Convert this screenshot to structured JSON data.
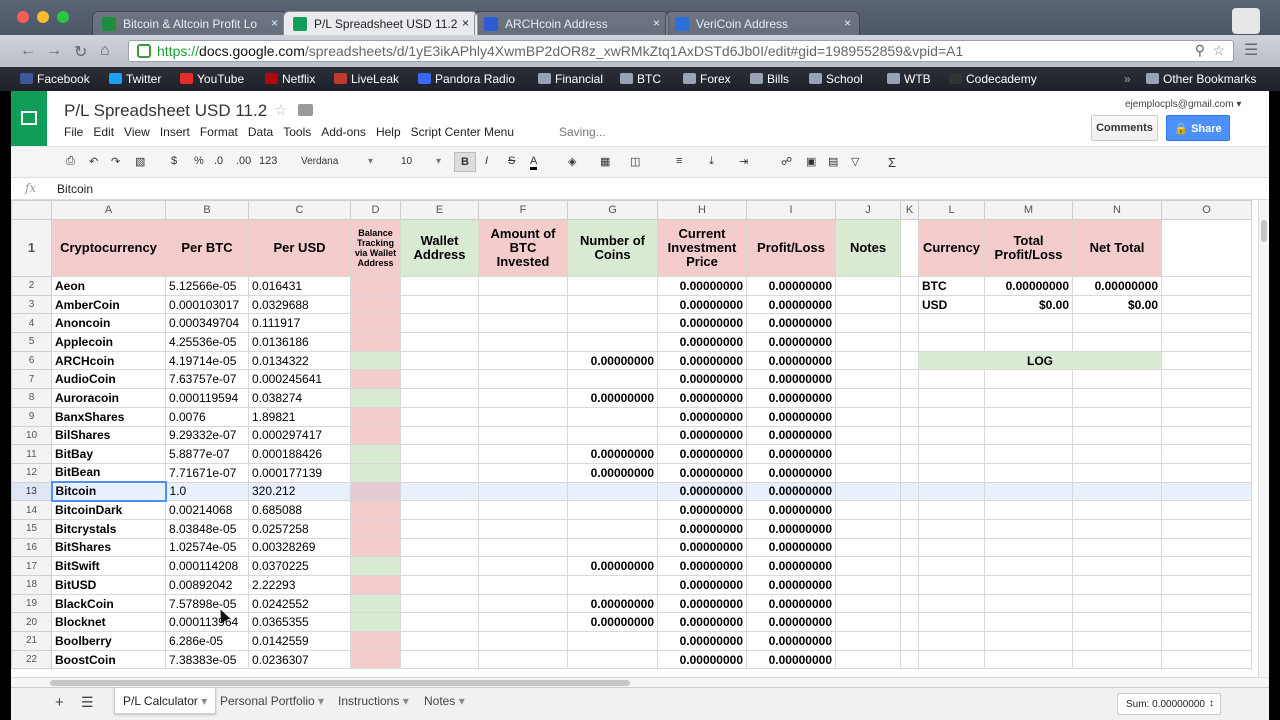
{
  "browser": {
    "tabs": [
      {
        "label": "Bitcoin & Altcoin Profit Lo",
        "favicon_color": "#1e8e3e",
        "active": false
      },
      {
        "label": "P/L Spreadsheet USD 11.2",
        "favicon_color": "#0f9d58",
        "active": true
      },
      {
        "label": "ARCHcoin Address",
        "favicon_color": "#2d5bd3",
        "active": false
      },
      {
        "label": "VeriCoin Address",
        "favicon_color": "#2a6fdb",
        "active": false
      }
    ],
    "url_prefix": "https://",
    "url_domain": "docs.google.com",
    "url_path": "/spreadsheets/d/1yE3ikAPhly4XwmBP2dOR8z_xwRMkZtq1AxDSTd6Jb0I/edit#gid=1989552859&vpid=A1",
    "bookmarks": [
      {
        "label": "Facebook",
        "color": "#3b5998"
      },
      {
        "label": "Twitter",
        "color": "#1da1f2"
      },
      {
        "label": "YouTube",
        "color": "#e52d27"
      },
      {
        "label": "Netflix",
        "color": "#b1060f"
      },
      {
        "label": "LiveLeak",
        "color": "#c0392b"
      },
      {
        "label": "Pandora Radio",
        "color": "#3668ff"
      },
      {
        "label": "Financial",
        "color": "#9aa3b5"
      },
      {
        "label": "BTC",
        "color": "#9aa3b5"
      },
      {
        "label": "Forex",
        "color": "#9aa3b5"
      },
      {
        "label": "Bills",
        "color": "#9aa3b5"
      },
      {
        "label": "School",
        "color": "#9aa3b5"
      },
      {
        "label": "WTB",
        "color": "#9aa3b5"
      },
      {
        "label": "Codecademy",
        "color": "#333333"
      }
    ],
    "overflow": "»",
    "other_bookmarks": "Other Bookmarks"
  },
  "doc": {
    "title": "P/L Spreadsheet USD 11.2",
    "menus": [
      "File",
      "Edit",
      "View",
      "Insert",
      "Format",
      "Data",
      "Tools",
      "Add-ons",
      "Help",
      "Script Center Menu"
    ],
    "status": "Saving...",
    "user_email": "ejemplocpls@gmail.com",
    "comments_label": "Comments",
    "share_label": "Share",
    "font_name": "Verdana",
    "font_size": "10",
    "fx_label": "fx",
    "formula_value": "Bitcoin"
  },
  "format_toolbar": {
    "currency": "$",
    "percent": "%",
    "dec_less": ".0",
    "dec_more": ".00",
    "more_formats": "123",
    "bold": "B",
    "italic": "I",
    "strike": "S",
    "text_color": "A",
    "sigma": "Σ"
  },
  "grid": {
    "columns": [
      "A",
      "B",
      "C",
      "D",
      "E",
      "F",
      "G",
      "H",
      "I",
      "J",
      "K",
      "L",
      "M",
      "N",
      "O"
    ],
    "headers": {
      "A": "Cryptocurrency",
      "B": "Per BTC",
      "C": "Per USD",
      "D": "Balance Tracking via Wallet Address",
      "E": "Wallet Address",
      "F": "Amount of BTC Invested",
      "G": "Number of Coins",
      "H": "Current Investment Price",
      "I": "Profit/Loss",
      "J": "Notes",
      "L": "Currency",
      "M": "Total Profit/Loss",
      "N": "Net Total"
    },
    "rows": [
      {
        "n": "2",
        "name": "Aeon",
        "btc": "5.12566e-05",
        "usd": "0.016431",
        "track": "pink",
        "coins": "",
        "price": "0.00000000",
        "pl": "0.00000000"
      },
      {
        "n": "3",
        "name": "AmberCoin",
        "btc": "0.000103017",
        "usd": "0.0329688",
        "track": "pink",
        "coins": "",
        "price": "0.00000000",
        "pl": "0.00000000"
      },
      {
        "n": "4",
        "name": "Anoncoin",
        "btc": "0.000349704",
        "usd": "0.111917",
        "track": "pink",
        "coins": "",
        "price": "0.00000000",
        "pl": "0.00000000"
      },
      {
        "n": "5",
        "name": "Applecoin",
        "btc": "4.25536e-05",
        "usd": "0.0136186",
        "track": "pink",
        "coins": "",
        "price": "0.00000000",
        "pl": "0.00000000"
      },
      {
        "n": "6",
        "name": "ARCHcoin",
        "btc": "4.19714e-05",
        "usd": "0.0134322",
        "track": "green",
        "coins": "0.00000000",
        "price": "0.00000000",
        "pl": "0.00000000"
      },
      {
        "n": "7",
        "name": "AudioCoin",
        "btc": "7.63757e-07",
        "usd": "0.000245641",
        "track": "pink",
        "coins": "",
        "price": "0.00000000",
        "pl": "0.00000000"
      },
      {
        "n": "8",
        "name": "Auroracoin",
        "btc": "0.000119594",
        "usd": "0.038274",
        "track": "green",
        "coins": "0.00000000",
        "price": "0.00000000",
        "pl": "0.00000000"
      },
      {
        "n": "9",
        "name": "BanxShares",
        "btc": "0.0076",
        "usd": "1.89821",
        "track": "pink",
        "coins": "",
        "price": "0.00000000",
        "pl": "0.00000000"
      },
      {
        "n": "10",
        "name": "BilShares",
        "btc": "9.29332e-07",
        "usd": "0.000297417",
        "track": "pink",
        "coins": "",
        "price": "0.00000000",
        "pl": "0.00000000"
      },
      {
        "n": "11",
        "name": "BitBay",
        "btc": "5.8877e-07",
        "usd": "0.000188426",
        "track": "green",
        "coins": "0.00000000",
        "price": "0.00000000",
        "pl": "0.00000000"
      },
      {
        "n": "12",
        "name": "BitBean",
        "btc": "7.71671e-07",
        "usd": "0.000177139",
        "track": "green",
        "coins": "0.00000000",
        "price": "0.00000000",
        "pl": "0.00000000"
      },
      {
        "n": "13",
        "name": "Bitcoin",
        "btc": "1.0",
        "usd": "320.212",
        "track": "pink",
        "coins": "",
        "price": "0.00000000",
        "pl": "0.00000000"
      },
      {
        "n": "14",
        "name": "BitcoinDark",
        "btc": "0.00214068",
        "usd": "0.685088",
        "track": "pink",
        "coins": "",
        "price": "0.00000000",
        "pl": "0.00000000"
      },
      {
        "n": "15",
        "name": "Bitcrystals",
        "btc": "8.03848e-05",
        "usd": "0.0257258",
        "track": "pink",
        "coins": "",
        "price": "0.00000000",
        "pl": "0.00000000"
      },
      {
        "n": "16",
        "name": "BitShares",
        "btc": "1.02574e-05",
        "usd": "0.00328269",
        "track": "pink",
        "coins": "",
        "price": "0.00000000",
        "pl": "0.00000000"
      },
      {
        "n": "17",
        "name": "BitSwift",
        "btc": "0.000114208",
        "usd": "0.0370225",
        "track": "green",
        "coins": "0.00000000",
        "price": "0.00000000",
        "pl": "0.00000000"
      },
      {
        "n": "18",
        "name": "BitUSD",
        "btc": "0.00892042",
        "usd": "2.22293",
        "track": "pink",
        "coins": "",
        "price": "0.00000000",
        "pl": "0.00000000"
      },
      {
        "n": "19",
        "name": "BlackCoin",
        "btc": "7.57898e-05",
        "usd": "0.0242552",
        "track": "green",
        "coins": "0.00000000",
        "price": "0.00000000",
        "pl": "0.00000000"
      },
      {
        "n": "20",
        "name": "Blocknet",
        "btc": "0.000113964",
        "usd": "0.0365355",
        "track": "green",
        "coins": "0.00000000",
        "price": "0.00000000",
        "pl": "0.00000000"
      },
      {
        "n": "21",
        "name": "Boolberry",
        "btc": "6.286e-05",
        "usd": "0.0142559",
        "track": "pink",
        "coins": "",
        "price": "0.00000000",
        "pl": "0.00000000"
      },
      {
        "n": "22",
        "name": "BoostCoin",
        "btc": "7.38383e-05",
        "usd": "0.0236307",
        "track": "pink",
        "coins": "",
        "price": "0.00000000",
        "pl": "0.00000000"
      }
    ],
    "summary": [
      {
        "currency": "BTC",
        "total": "0.00000000",
        "net": "0.00000000"
      },
      {
        "currency": "USD",
        "total": "$0.00",
        "net": "$0.00"
      }
    ],
    "log_label": "LOG",
    "selected_row": "13"
  },
  "sheet_tabs": [
    "P/L Calculator",
    "Personal Portfolio",
    "Instructions",
    "Notes"
  ],
  "active_sheet": "P/L Calculator",
  "sum_label": "Sum: 0.00000000",
  "colors": {
    "pink": "#f4cccc",
    "green": "#d9ead3",
    "share": "#4d90fe",
    "sheets_green": "#0f9d58"
  }
}
